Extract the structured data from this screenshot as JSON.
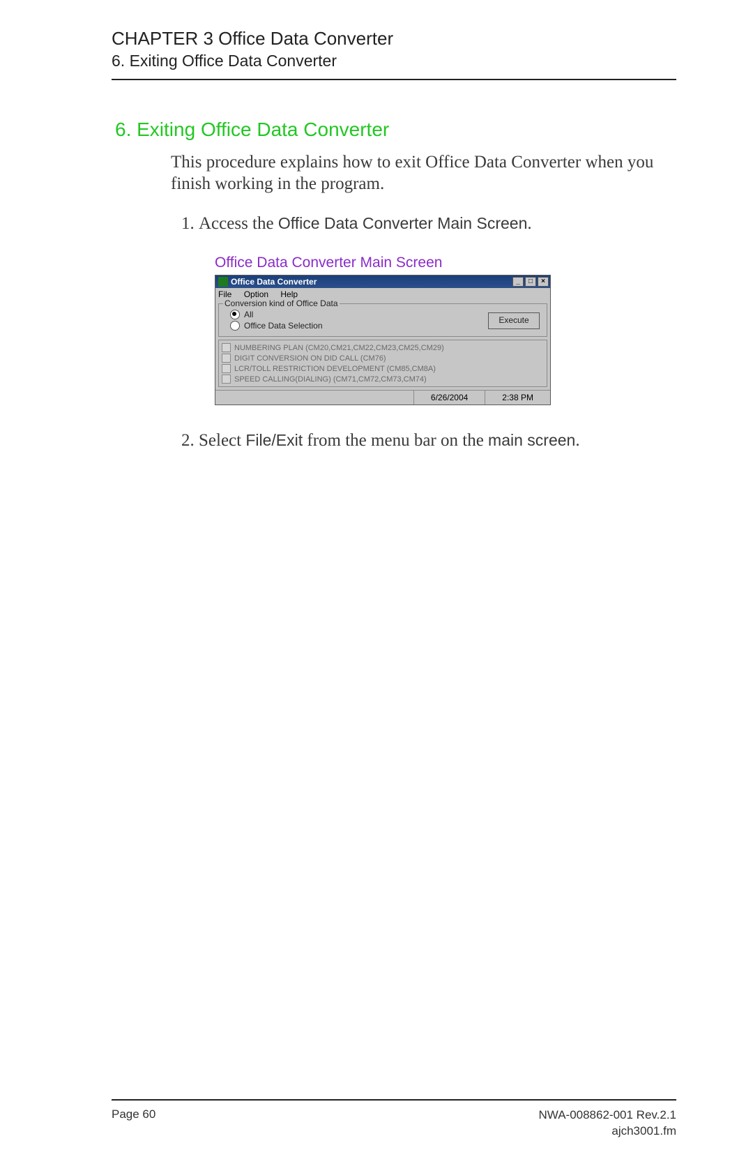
{
  "header": {
    "chapter": "CHAPTER 3 Office Data Converter",
    "section": "6. Exiting Office Data Converter"
  },
  "heading": "6.  Exiting Office Data Converter",
  "intro": "This procedure explains how to exit Office Data Converter when you finish working in the program.",
  "steps": {
    "s1_pre": "Access the ",
    "s1_bold": "Office Data Converter Main Screen",
    "s1_post": ".",
    "s2_pre": "Select ",
    "s2_b1": "File/Exit",
    "s2_mid": " from the menu bar on the ",
    "s2_b2": "main screen",
    "s2_post": "."
  },
  "figcap": "Office Data Converter Main Screen",
  "window": {
    "title": "Office Data Converter",
    "menus": {
      "file": "File",
      "option": "Option",
      "help": "Help"
    },
    "group_legend": "Conversion kind of Office Data",
    "radio_all": "All",
    "radio_sel": "Office Data Selection",
    "exec_btn": "Execute",
    "list": [
      "NUMBERING PLAN (CM20,CM21,CM22,CM23,CM25,CM29)",
      "DIGIT CONVERSION ON DID CALL (CM76)",
      "LCR/TOLL RESTRICTION DEVELOPMENT (CM85,CM8A)",
      "SPEED CALLING(DIALING) (CM71,CM72,CM73,CM74)"
    ],
    "status_date": "6/26/2004",
    "status_time": "2:38 PM"
  },
  "footer": {
    "page": "Page 60",
    "docid": "NWA-008862-001 Rev.2.1",
    "file": "ajch3001.fm"
  }
}
